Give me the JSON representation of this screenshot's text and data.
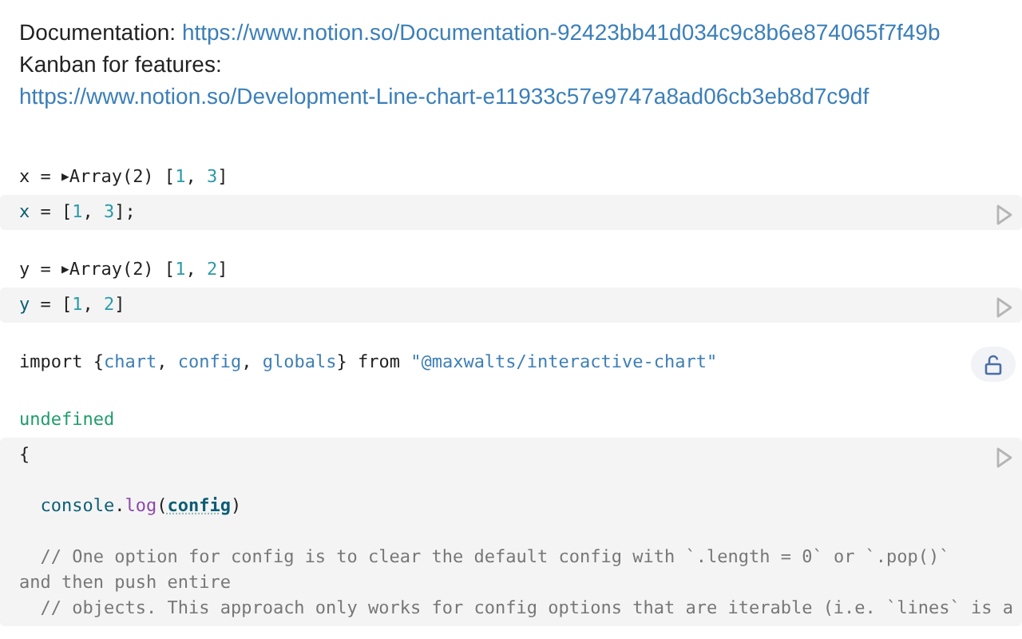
{
  "intro": {
    "parts": [
      {
        "kind": "text",
        "text": "Documentation: "
      },
      {
        "kind": "link",
        "text": "https://www.notion.so/Documentation-92423bb41d034c9c8b6e874065f7f49b"
      },
      {
        "kind": "text",
        "text": " Kanban for features: "
      },
      {
        "kind": "link",
        "text": "https://www.notion.so/Development-Line-chart-e11933c57e9747a8ad06cb3eb8d7c9df"
      }
    ]
  },
  "cells": [
    {
      "kind": "run",
      "output": [
        {
          "kind": "plain",
          "t": "x = "
        },
        {
          "kind": "caret",
          "t": "▶"
        },
        {
          "kind": "plain",
          "t": "Array(2) ["
        },
        {
          "kind": "num",
          "t": "1"
        },
        {
          "kind": "plain",
          "t": ", "
        },
        {
          "kind": "num",
          "t": "3"
        },
        {
          "kind": "plain",
          "t": "]"
        }
      ],
      "code": [
        {
          "blank_before": false,
          "tokens": [
            {
              "kind": "def",
              "t": "x"
            },
            {
              "kind": "plain",
              "t": " = ["
            },
            {
              "kind": "num",
              "t": "1"
            },
            {
              "kind": "plain",
              "t": ", "
            },
            {
              "kind": "num",
              "t": "3"
            },
            {
              "kind": "plain",
              "t": "];"
            }
          ]
        }
      ]
    },
    {
      "kind": "run",
      "output": [
        {
          "kind": "plain",
          "t": "y = "
        },
        {
          "kind": "caret",
          "t": "▶"
        },
        {
          "kind": "plain",
          "t": "Array(2) ["
        },
        {
          "kind": "num",
          "t": "1"
        },
        {
          "kind": "plain",
          "t": ", "
        },
        {
          "kind": "num",
          "t": "2"
        },
        {
          "kind": "plain",
          "t": "]"
        }
      ],
      "code": [
        {
          "blank_before": false,
          "tokens": [
            {
              "kind": "def",
              "t": "y"
            },
            {
              "kind": "plain",
              "t": " = ["
            },
            {
              "kind": "num",
              "t": "1"
            },
            {
              "kind": "plain",
              "t": ", "
            },
            {
              "kind": "num",
              "t": "2"
            },
            {
              "kind": "plain",
              "t": "]"
            }
          ]
        }
      ]
    },
    {
      "kind": "lock",
      "output": [
        {
          "kind": "plain",
          "t": "import {"
        },
        {
          "kind": "name",
          "t": "chart"
        },
        {
          "kind": "plain",
          "t": ", "
        },
        {
          "kind": "name",
          "t": "config"
        },
        {
          "kind": "plain",
          "t": ", "
        },
        {
          "kind": "name",
          "t": "globals"
        },
        {
          "kind": "plain",
          "t": "} from "
        },
        {
          "kind": "str",
          "t": "\"@maxwalts/interactive-chart\""
        }
      ]
    },
    {
      "kind": "run",
      "output": [
        {
          "kind": "undef",
          "t": "undefined"
        }
      ],
      "code": [
        {
          "blank_before": false,
          "tokens": [
            {
              "kind": "plain",
              "t": "{"
            }
          ]
        },
        {
          "blank_before": true,
          "tokens": [
            {
              "kind": "def",
              "t": "  console"
            },
            {
              "kind": "plain",
              "t": "."
            },
            {
              "kind": "fn",
              "t": "log"
            },
            {
              "kind": "plain",
              "t": "("
            },
            {
              "kind": "ref",
              "t": "config"
            },
            {
              "kind": "plain",
              "t": ")"
            }
          ]
        },
        {
          "blank_before": true,
          "tokens": [
            {
              "kind": "comment",
              "t": "  // One option for config is to clear the default config with `.length = 0` or `.pop()` and then push entire"
            }
          ]
        },
        {
          "blank_before": false,
          "tokens": [
            {
              "kind": "comment",
              "t": "  // objects. This approach only works for config options that are iterable (i.e. `lines` is a"
            }
          ]
        }
      ]
    }
  ]
}
